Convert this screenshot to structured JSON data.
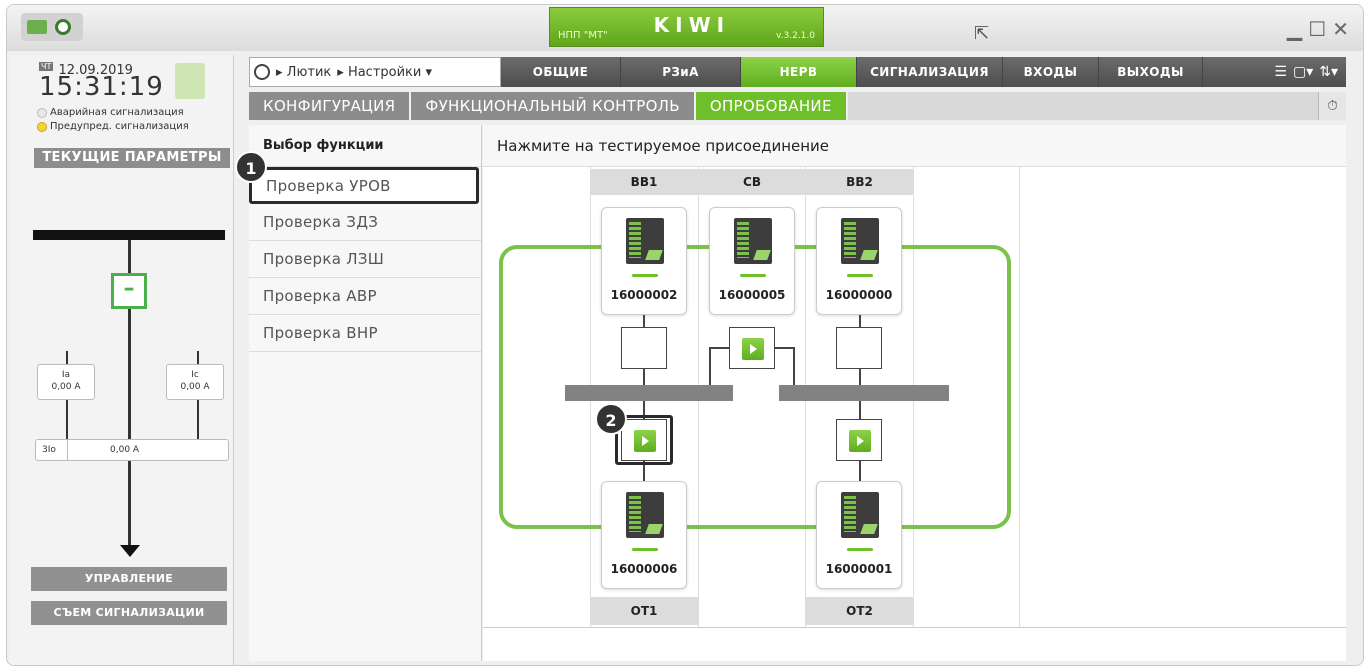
{
  "title_bar": {
    "company": "НПП \"МТ\"",
    "product": "KIWI",
    "version": "v.3.2.1.0"
  },
  "left_panel": {
    "day": "ЧТ",
    "date": "12.09.2019",
    "time": "15:31:19",
    "alarm_label": "Аварийная сигнализация",
    "warning_label": "Предупред. сигнализация",
    "current_params_label": "ТЕКУЩИЕ ПАРАМЕТРЫ",
    "meters": {
      "ia_label": "Ia",
      "ia_value": "0,00 A",
      "ic_label": "Ic",
      "ic_value": "0,00 A",
      "i3o_label": "3Io",
      "i3o_value": "0,00 A"
    },
    "control_button": "УПРАВЛЕНИЕ",
    "reset_button": "СЪЕМ СИГНАЛИЗАЦИИ"
  },
  "nav": {
    "breadcrumb1": "Лютик",
    "breadcrumb2": "Настройки",
    "tabs": [
      "ОБЩИЕ",
      "РЗиА",
      "НЕРВ",
      "СИГНАЛИЗАЦИЯ",
      "ВХОДЫ",
      "ВЫХОДЫ"
    ],
    "active_tab": "НЕРВ"
  },
  "subtabs": {
    "items": [
      "КОНФИГУРАЦИЯ",
      "ФУНКЦИОНАЛЬНЫЙ КОНТРОЛЬ",
      "ОПРОБОВАНИЕ"
    ],
    "active": "ОПРОБОВАНИЕ"
  },
  "functions": {
    "header": "Выбор функции",
    "items": [
      "Проверка УРОВ",
      "Проверка ЗДЗ",
      "Проверка ЛЗШ",
      "Проверка АВР",
      "Проверка ВНР"
    ],
    "selected": "Проверка УРОВ"
  },
  "main": {
    "instruction": "Нажмите на тестируемое присоединение",
    "columns": [
      "ВВ1",
      "СВ",
      "ВВ2"
    ],
    "footers": [
      "ОТ1",
      "ОТ2"
    ],
    "devices": {
      "bb1": "16000002",
      "cb": "16000005",
      "bb2": "16000000",
      "ot1": "16000006",
      "ot2": "16000001"
    }
  },
  "markers": [
    "1",
    "2"
  ],
  "colors": {
    "accent_green": "#6fbf2a",
    "nav_dark": "#555555",
    "highlight": "#2a2a2a"
  }
}
